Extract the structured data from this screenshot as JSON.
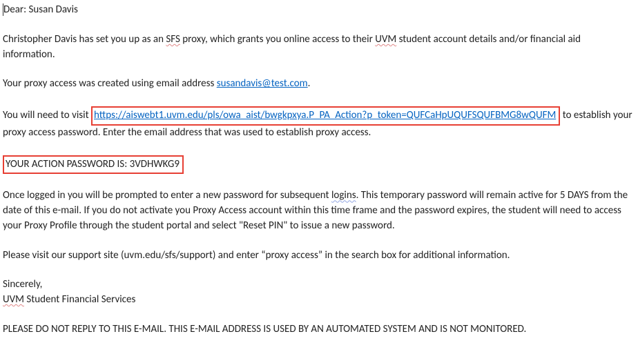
{
  "greeting": {
    "prefix": "Dear:",
    "name": "Susan Davis"
  },
  "intro": {
    "part1": "Christopher Davis has set you up as an ",
    "sfs": "SFS",
    "part2": " proxy, which grants you online access to their ",
    "uvm": "UVM",
    "part3": " student account details and/or financial aid information."
  },
  "email_line": {
    "part1": "Your proxy access was created using email address ",
    "email": "susandavis@test.com",
    "part2": "."
  },
  "visit": {
    "part1": "You will need to visit ",
    "url": "https://aiswebt1.uvm.edu/pls/owa_aist/bwgkpxya.P_PA_Action?p_token=QUFCaHpUQUFSQUFBMG8wQUFM",
    "part2": "to establish your proxy access password. Enter the email address that was used to establish proxy access."
  },
  "action_password": {
    "label": "YOUR ACTION PASSWORD IS:",
    "value": "3VDHWKG9"
  },
  "body2": {
    "part1": "Once logged in you will be prompted to enter a new password for subsequent ",
    "logins": "logins",
    "part2": ". This temporary password will remain active for 5 DAYS from the date of this e-mail. If you do not activate you Proxy Access account within this time frame and the password expires, the student will need to access your Proxy Profile through the student portal and select \"Reset PIN\" to issue a new password."
  },
  "support": "Please visit our support site (uvm.edu/sfs/support) and enter “proxy access” in the search box for additional information.",
  "signature": {
    "line1": "Sincerely,",
    "line2_a": "UVM",
    "line2_b": " Student Financial Services"
  },
  "footer": "PLEASE DO NOT REPLY TO THIS E-MAIL. THIS E-MAIL ADDRESS IS USED BY AN AUTOMATED SYSTEM AND IS NOT MONITORED."
}
